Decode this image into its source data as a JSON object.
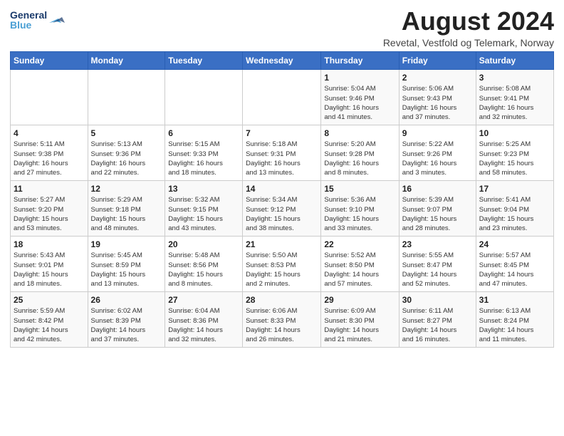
{
  "header": {
    "logo_general": "General",
    "logo_blue": "Blue",
    "month_title": "August 2024",
    "subtitle": "Revetal, Vestfold og Telemark, Norway"
  },
  "days_of_week": [
    "Sunday",
    "Monday",
    "Tuesday",
    "Wednesday",
    "Thursday",
    "Friday",
    "Saturday"
  ],
  "weeks": [
    {
      "days": [
        {
          "num": "",
          "content": ""
        },
        {
          "num": "",
          "content": ""
        },
        {
          "num": "",
          "content": ""
        },
        {
          "num": "",
          "content": ""
        },
        {
          "num": "1",
          "content": "Sunrise: 5:04 AM\nSunset: 9:46 PM\nDaylight: 16 hours\nand 41 minutes."
        },
        {
          "num": "2",
          "content": "Sunrise: 5:06 AM\nSunset: 9:43 PM\nDaylight: 16 hours\nand 37 minutes."
        },
        {
          "num": "3",
          "content": "Sunrise: 5:08 AM\nSunset: 9:41 PM\nDaylight: 16 hours\nand 32 minutes."
        }
      ]
    },
    {
      "days": [
        {
          "num": "4",
          "content": "Sunrise: 5:11 AM\nSunset: 9:38 PM\nDaylight: 16 hours\nand 27 minutes."
        },
        {
          "num": "5",
          "content": "Sunrise: 5:13 AM\nSunset: 9:36 PM\nDaylight: 16 hours\nand 22 minutes."
        },
        {
          "num": "6",
          "content": "Sunrise: 5:15 AM\nSunset: 9:33 PM\nDaylight: 16 hours\nand 18 minutes."
        },
        {
          "num": "7",
          "content": "Sunrise: 5:18 AM\nSunset: 9:31 PM\nDaylight: 16 hours\nand 13 minutes."
        },
        {
          "num": "8",
          "content": "Sunrise: 5:20 AM\nSunset: 9:28 PM\nDaylight: 16 hours\nand 8 minutes."
        },
        {
          "num": "9",
          "content": "Sunrise: 5:22 AM\nSunset: 9:26 PM\nDaylight: 16 hours\nand 3 minutes."
        },
        {
          "num": "10",
          "content": "Sunrise: 5:25 AM\nSunset: 9:23 PM\nDaylight: 15 hours\nand 58 minutes."
        }
      ]
    },
    {
      "days": [
        {
          "num": "11",
          "content": "Sunrise: 5:27 AM\nSunset: 9:20 PM\nDaylight: 15 hours\nand 53 minutes."
        },
        {
          "num": "12",
          "content": "Sunrise: 5:29 AM\nSunset: 9:18 PM\nDaylight: 15 hours\nand 48 minutes."
        },
        {
          "num": "13",
          "content": "Sunrise: 5:32 AM\nSunset: 9:15 PM\nDaylight: 15 hours\nand 43 minutes."
        },
        {
          "num": "14",
          "content": "Sunrise: 5:34 AM\nSunset: 9:12 PM\nDaylight: 15 hours\nand 38 minutes."
        },
        {
          "num": "15",
          "content": "Sunrise: 5:36 AM\nSunset: 9:10 PM\nDaylight: 15 hours\nand 33 minutes."
        },
        {
          "num": "16",
          "content": "Sunrise: 5:39 AM\nSunset: 9:07 PM\nDaylight: 15 hours\nand 28 minutes."
        },
        {
          "num": "17",
          "content": "Sunrise: 5:41 AM\nSunset: 9:04 PM\nDaylight: 15 hours\nand 23 minutes."
        }
      ]
    },
    {
      "days": [
        {
          "num": "18",
          "content": "Sunrise: 5:43 AM\nSunset: 9:01 PM\nDaylight: 15 hours\nand 18 minutes."
        },
        {
          "num": "19",
          "content": "Sunrise: 5:45 AM\nSunset: 8:59 PM\nDaylight: 15 hours\nand 13 minutes."
        },
        {
          "num": "20",
          "content": "Sunrise: 5:48 AM\nSunset: 8:56 PM\nDaylight: 15 hours\nand 8 minutes."
        },
        {
          "num": "21",
          "content": "Sunrise: 5:50 AM\nSunset: 8:53 PM\nDaylight: 15 hours\nand 2 minutes."
        },
        {
          "num": "22",
          "content": "Sunrise: 5:52 AM\nSunset: 8:50 PM\nDaylight: 14 hours\nand 57 minutes."
        },
        {
          "num": "23",
          "content": "Sunrise: 5:55 AM\nSunset: 8:47 PM\nDaylight: 14 hours\nand 52 minutes."
        },
        {
          "num": "24",
          "content": "Sunrise: 5:57 AM\nSunset: 8:45 PM\nDaylight: 14 hours\nand 47 minutes."
        }
      ]
    },
    {
      "days": [
        {
          "num": "25",
          "content": "Sunrise: 5:59 AM\nSunset: 8:42 PM\nDaylight: 14 hours\nand 42 minutes."
        },
        {
          "num": "26",
          "content": "Sunrise: 6:02 AM\nSunset: 8:39 PM\nDaylight: 14 hours\nand 37 minutes."
        },
        {
          "num": "27",
          "content": "Sunrise: 6:04 AM\nSunset: 8:36 PM\nDaylight: 14 hours\nand 32 minutes."
        },
        {
          "num": "28",
          "content": "Sunrise: 6:06 AM\nSunset: 8:33 PM\nDaylight: 14 hours\nand 26 minutes."
        },
        {
          "num": "29",
          "content": "Sunrise: 6:09 AM\nSunset: 8:30 PM\nDaylight: 14 hours\nand 21 minutes."
        },
        {
          "num": "30",
          "content": "Sunrise: 6:11 AM\nSunset: 8:27 PM\nDaylight: 14 hours\nand 16 minutes."
        },
        {
          "num": "31",
          "content": "Sunrise: 6:13 AM\nSunset: 8:24 PM\nDaylight: 14 hours\nand 11 minutes."
        }
      ]
    }
  ]
}
